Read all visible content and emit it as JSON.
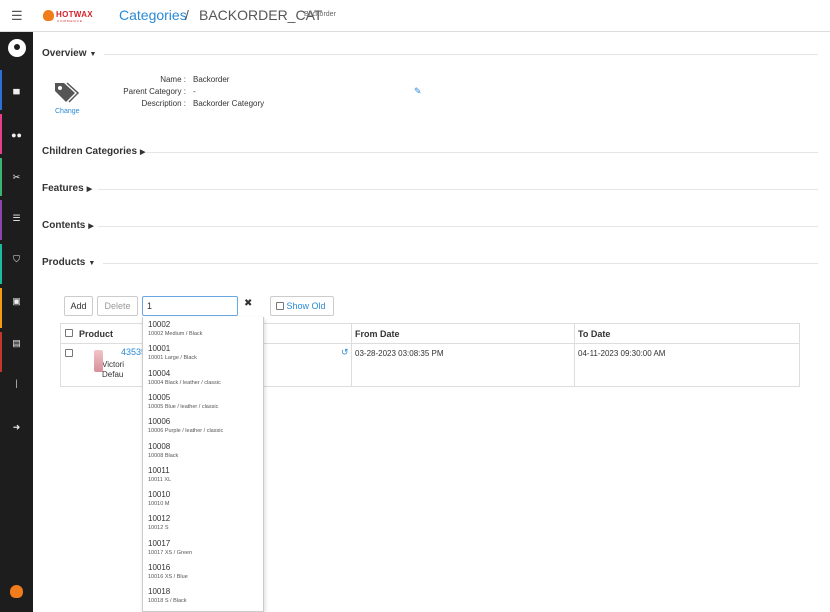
{
  "header": {
    "logo_text": "HOTWAX",
    "logo_sub": "COMMERCE",
    "breadcrumb_link": "Categories",
    "breadcrumb_sep": "/",
    "breadcrumb_current": "BACKORDER_CAT",
    "breadcrumb_tag": "Backorder"
  },
  "sidebar": {
    "items": [
      "user-avatar",
      "cart-icon",
      "users-icon",
      "tools-icon",
      "list-icon",
      "shield-icon",
      "camera-icon",
      "database-icon",
      "divider",
      "logout-icon"
    ],
    "stripe_colors": [
      "#2c6fd6",
      "#e83e8c",
      "#3cb371",
      "#8e44ad",
      "#1abc9c",
      "#f39c12",
      "#c0392b"
    ]
  },
  "overview": {
    "title": "Overview",
    "change": "Change",
    "name_label": "Name :",
    "name_value": "Backorder",
    "parent_label": "Parent Category :",
    "parent_value": "-",
    "desc_label": "Description :",
    "desc_value": "Backorder Category"
  },
  "sections": {
    "children": "Children Categories",
    "features": "Features",
    "contents": "Contents",
    "products": "Products"
  },
  "toolbar": {
    "add": "Add",
    "delete": "Delete",
    "search_value": "1",
    "clear": "✖",
    "show_old": "Show Old"
  },
  "table": {
    "headers": {
      "product": "Product",
      "from": "From Date",
      "to": "To Date"
    },
    "row": {
      "product_id": "43535",
      "line2": "Victori",
      "line3": "Defau",
      "from": "03-28-2023 03:08:35 PM",
      "to": "04-11-2023 09:30:00 AM"
    }
  },
  "dropdown": [
    {
      "id": "10002",
      "desc": "10002 Medium / Black"
    },
    {
      "id": "10001",
      "desc": "10001 Large / Black"
    },
    {
      "id": "10004",
      "desc": "10004 Black / leather / classic"
    },
    {
      "id": "10005",
      "desc": "10005 Blue / leather / classic"
    },
    {
      "id": "10006",
      "desc": "10006 Purple / leather / classic"
    },
    {
      "id": "10008",
      "desc": "10008 Black"
    },
    {
      "id": "10011",
      "desc": "10011 XL"
    },
    {
      "id": "10010",
      "desc": "10010 M"
    },
    {
      "id": "10012",
      "desc": "10012 S"
    },
    {
      "id": "10017",
      "desc": "10017 XS / Green"
    },
    {
      "id": "10016",
      "desc": "10016 XS / Blue"
    },
    {
      "id": "10018",
      "desc": "10018 S / Black"
    }
  ]
}
